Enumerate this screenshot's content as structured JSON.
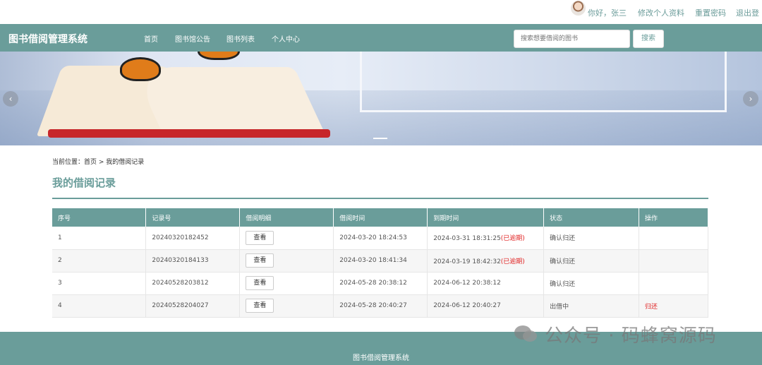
{
  "userbar": {
    "greeting": "你好，张三",
    "edit_profile": "修改个人资料",
    "reset_password": "重置密码",
    "logout": "退出登"
  },
  "nav": {
    "brand": "图书借阅管理系统",
    "items": [
      "首页",
      "图书馆公告",
      "图书列表",
      "个人中心"
    ],
    "search_placeholder": "搜索想要借阅的图书",
    "search_button": "搜索"
  },
  "banner": {
    "prev": "‹",
    "next": "›"
  },
  "breadcrumb": {
    "prefix": "当前位置：",
    "home": "首页",
    "separator": " > ",
    "current": "我的借阅记录"
  },
  "page_title": "我的借阅记录",
  "table": {
    "headers": [
      "序号",
      "记录号",
      "借阅明细",
      "借阅时间",
      "到期时间",
      "状态",
      "操作"
    ],
    "rows": [
      {
        "index": "1",
        "record_no": "20240320182452",
        "detail": "查看",
        "borrow_time": "2024-03-20 18:24:53",
        "due_time": "2024-03-31 18:31:25",
        "due_tag": "(已逾期)",
        "status": "确认归还",
        "action": ""
      },
      {
        "index": "2",
        "record_no": "20240320184133",
        "detail": "查看",
        "borrow_time": "2024-03-20 18:41:34",
        "due_time": "2024-03-19 18:42:32",
        "due_tag": "(已逾期)",
        "status": "确认归还",
        "action": ""
      },
      {
        "index": "3",
        "record_no": "20240528203812",
        "detail": "查看",
        "borrow_time": "2024-05-28 20:38:12",
        "due_time": "2024-06-12 20:38:12",
        "due_tag": "",
        "status": "确认归还",
        "action": ""
      },
      {
        "index": "4",
        "record_no": "20240528204027",
        "detail": "查看",
        "borrow_time": "2024-05-28 20:40:27",
        "due_time": "2024-06-12 20:40:27",
        "due_tag": "",
        "status": "出借中",
        "action": "归还"
      }
    ]
  },
  "footer": {
    "text": "图书借阅管理系统"
  },
  "watermark": "公众号 · 码蜂窝源码",
  "colors": {
    "accent": "#6a9d9a",
    "overdue": "#e02020"
  }
}
